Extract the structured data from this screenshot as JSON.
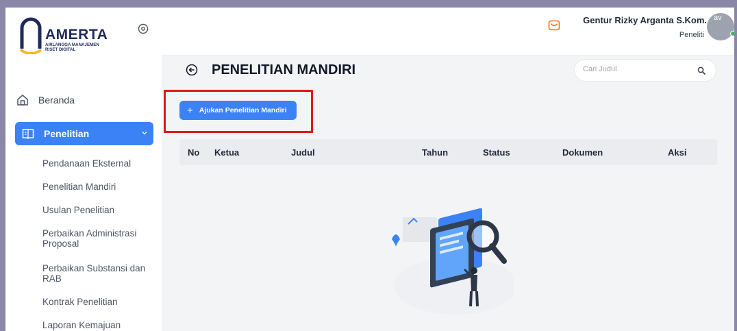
{
  "brand": {
    "title": "AMERTA",
    "subtitle_line1": "AIRLANGGA MANAJEMEN",
    "subtitle_line2": "RISET DIGITAL",
    "colors": {
      "navy": "#1e2a5a",
      "gold": "#f5b82e"
    }
  },
  "sidebar": {
    "home_label": "Beranda",
    "research_label": "Penelitian",
    "submenu": [
      {
        "label": "Pendanaan Eksternal"
      },
      {
        "label": "Penelitian Mandiri"
      },
      {
        "label": "Usulan Penelitian"
      },
      {
        "label": "Perbaikan Administrasi Proposal"
      },
      {
        "label": "Perbaikan Substansi dan RAB"
      },
      {
        "label": "Kontrak Penelitian"
      },
      {
        "label": "Laporan Kemajuan"
      }
    ]
  },
  "user": {
    "name": "Gentur Rizky Arganta S.Kom.",
    "role": "Peneliti",
    "avatar_alt": "av"
  },
  "page": {
    "title": "PENELITIAN MANDIRI",
    "search_placeholder": "Cari Judul",
    "add_button_label": "Ajukan Penelitian Mandiri"
  },
  "table": {
    "headers": [
      "No",
      "Ketua",
      "Judul",
      "Tahun",
      "Status",
      "Dokumen",
      "Aksi"
    ]
  },
  "colors": {
    "primary": "#3b82f6",
    "highlight_red": "#e01818",
    "online": "#22c55e",
    "mail_icon": "#f97316"
  }
}
